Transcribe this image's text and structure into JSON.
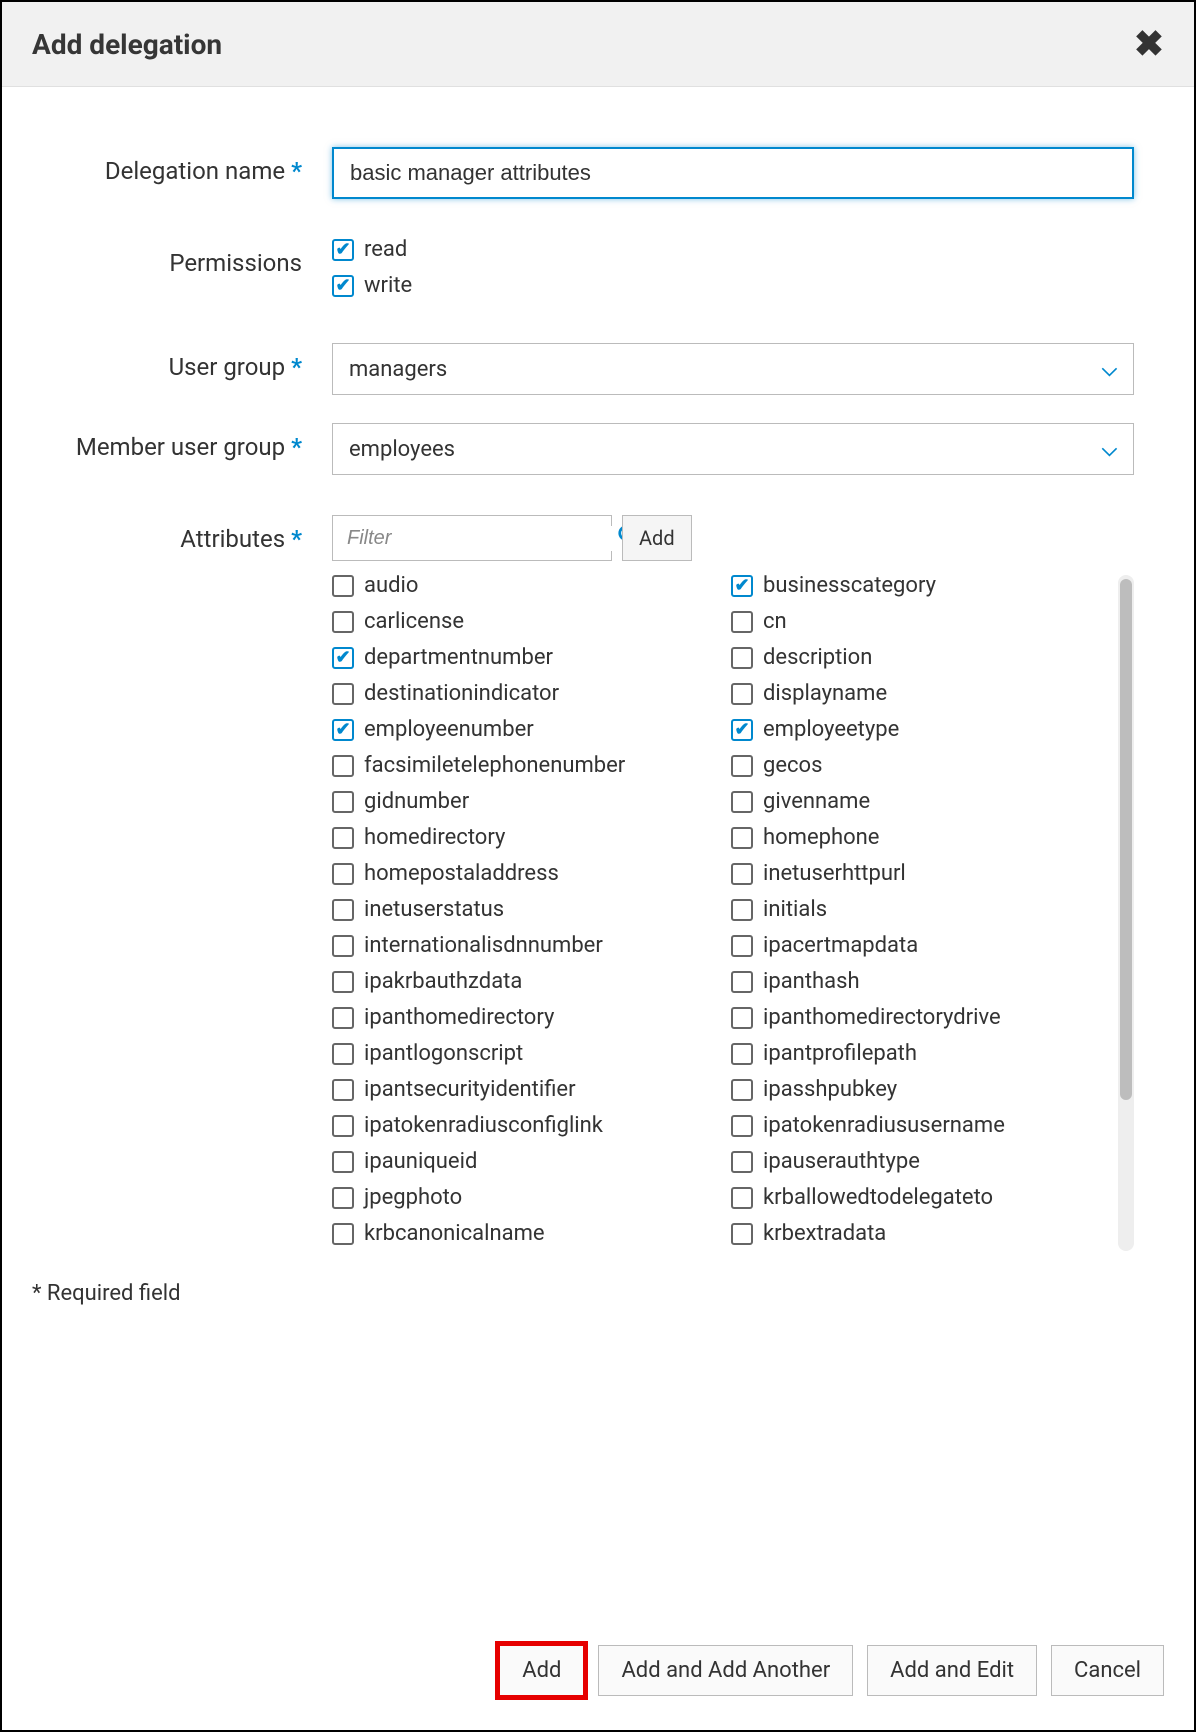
{
  "header": {
    "title": "Add delegation"
  },
  "fields": {
    "delegation_name": {
      "label": "Delegation name",
      "required": true,
      "value": "basic manager attributes"
    },
    "permissions": {
      "label": "Permissions",
      "required": false,
      "options": [
        {
          "label": "read",
          "checked": true
        },
        {
          "label": "write",
          "checked": true
        }
      ]
    },
    "user_group": {
      "label": "User group",
      "required": true,
      "value": "managers"
    },
    "member_user_group": {
      "label": "Member user group",
      "required": true,
      "value": "employees"
    },
    "attributes": {
      "label": "Attributes",
      "required": true,
      "filter_placeholder": "Filter",
      "add_label": "Add",
      "items": [
        {
          "label": "audio",
          "checked": false
        },
        {
          "label": "businesscategory",
          "checked": true
        },
        {
          "label": "carlicense",
          "checked": false
        },
        {
          "label": "cn",
          "checked": false
        },
        {
          "label": "departmentnumber",
          "checked": true
        },
        {
          "label": "description",
          "checked": false
        },
        {
          "label": "destinationindicator",
          "checked": false
        },
        {
          "label": "displayname",
          "checked": false
        },
        {
          "label": "employeenumber",
          "checked": true
        },
        {
          "label": "employeetype",
          "checked": true
        },
        {
          "label": "facsimiletelephonenumber",
          "checked": false
        },
        {
          "label": "gecos",
          "checked": false
        },
        {
          "label": "gidnumber",
          "checked": false
        },
        {
          "label": "givenname",
          "checked": false
        },
        {
          "label": "homedirectory",
          "checked": false
        },
        {
          "label": "homephone",
          "checked": false
        },
        {
          "label": "homepostaladdress",
          "checked": false
        },
        {
          "label": "inetuserhttpurl",
          "checked": false
        },
        {
          "label": "inetuserstatus",
          "checked": false
        },
        {
          "label": "initials",
          "checked": false
        },
        {
          "label": "internationalisdnnumber",
          "checked": false
        },
        {
          "label": "ipacertmapdata",
          "checked": false
        },
        {
          "label": "ipakrbauthzdata",
          "checked": false
        },
        {
          "label": "ipanthash",
          "checked": false
        },
        {
          "label": "ipanthomedirectory",
          "checked": false
        },
        {
          "label": "ipanthomedirectorydrive",
          "checked": false
        },
        {
          "label": "ipantlogonscript",
          "checked": false
        },
        {
          "label": "ipantprofilepath",
          "checked": false
        },
        {
          "label": "ipantsecurityidentifier",
          "checked": false
        },
        {
          "label": "ipasshpubkey",
          "checked": false
        },
        {
          "label": "ipatokenradiusconfiglink",
          "checked": false
        },
        {
          "label": "ipatokenradiususername",
          "checked": false
        },
        {
          "label": "ipauniqueid",
          "checked": false
        },
        {
          "label": "ipauserauthtype",
          "checked": false
        },
        {
          "label": "jpegphoto",
          "checked": false
        },
        {
          "label": "krballowedtodelegateto",
          "checked": false
        },
        {
          "label": "krbcanonicalname",
          "checked": false
        },
        {
          "label": "krbextradata",
          "checked": false
        }
      ]
    }
  },
  "required_note": "* Required field",
  "footer": {
    "add": "Add",
    "add_another": "Add and Add Another",
    "add_edit": "Add and Edit",
    "cancel": "Cancel"
  }
}
